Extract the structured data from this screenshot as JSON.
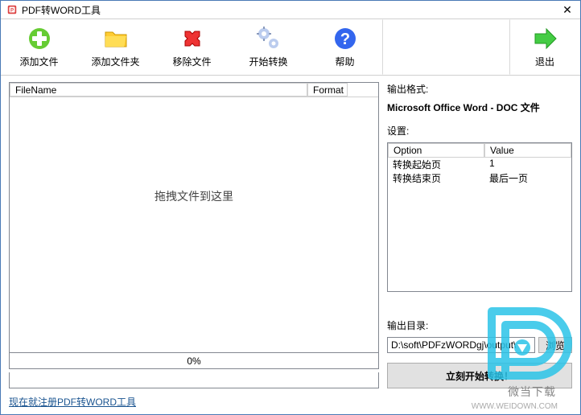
{
  "window": {
    "title": "PDF转WORD工具"
  },
  "toolbar": {
    "add_file": "添加文件",
    "add_folder": "添加文件夹",
    "remove_file": "移除文件",
    "start_convert": "开始转换",
    "help": "帮助",
    "exit": "退出"
  },
  "filelist": {
    "col_filename": "FileName",
    "col_format": "Format",
    "drop_hint": "拖拽文件到这里",
    "progress": "0%"
  },
  "output": {
    "format_label": "输出格式:",
    "format_value": "Microsoft Office Word - DOC 文件",
    "settings_label": "设置:",
    "col_option": "Option",
    "col_value": "Value",
    "rows": [
      {
        "option": "转换起始页",
        "value": "1"
      },
      {
        "option": "转换结束页",
        "value": "最后一页"
      }
    ],
    "dir_label": "输出目录:",
    "dir_value": "D:\\soft\\PDFzWORDgj\\output\\",
    "browse": "浏览",
    "start_now": "立刻开始转换！"
  },
  "footer": {
    "register_link": "现在就注册PDF转WORD工具"
  },
  "watermark": {
    "text": "微当下载",
    "url": "WWW.WEIDOWN.COM"
  }
}
